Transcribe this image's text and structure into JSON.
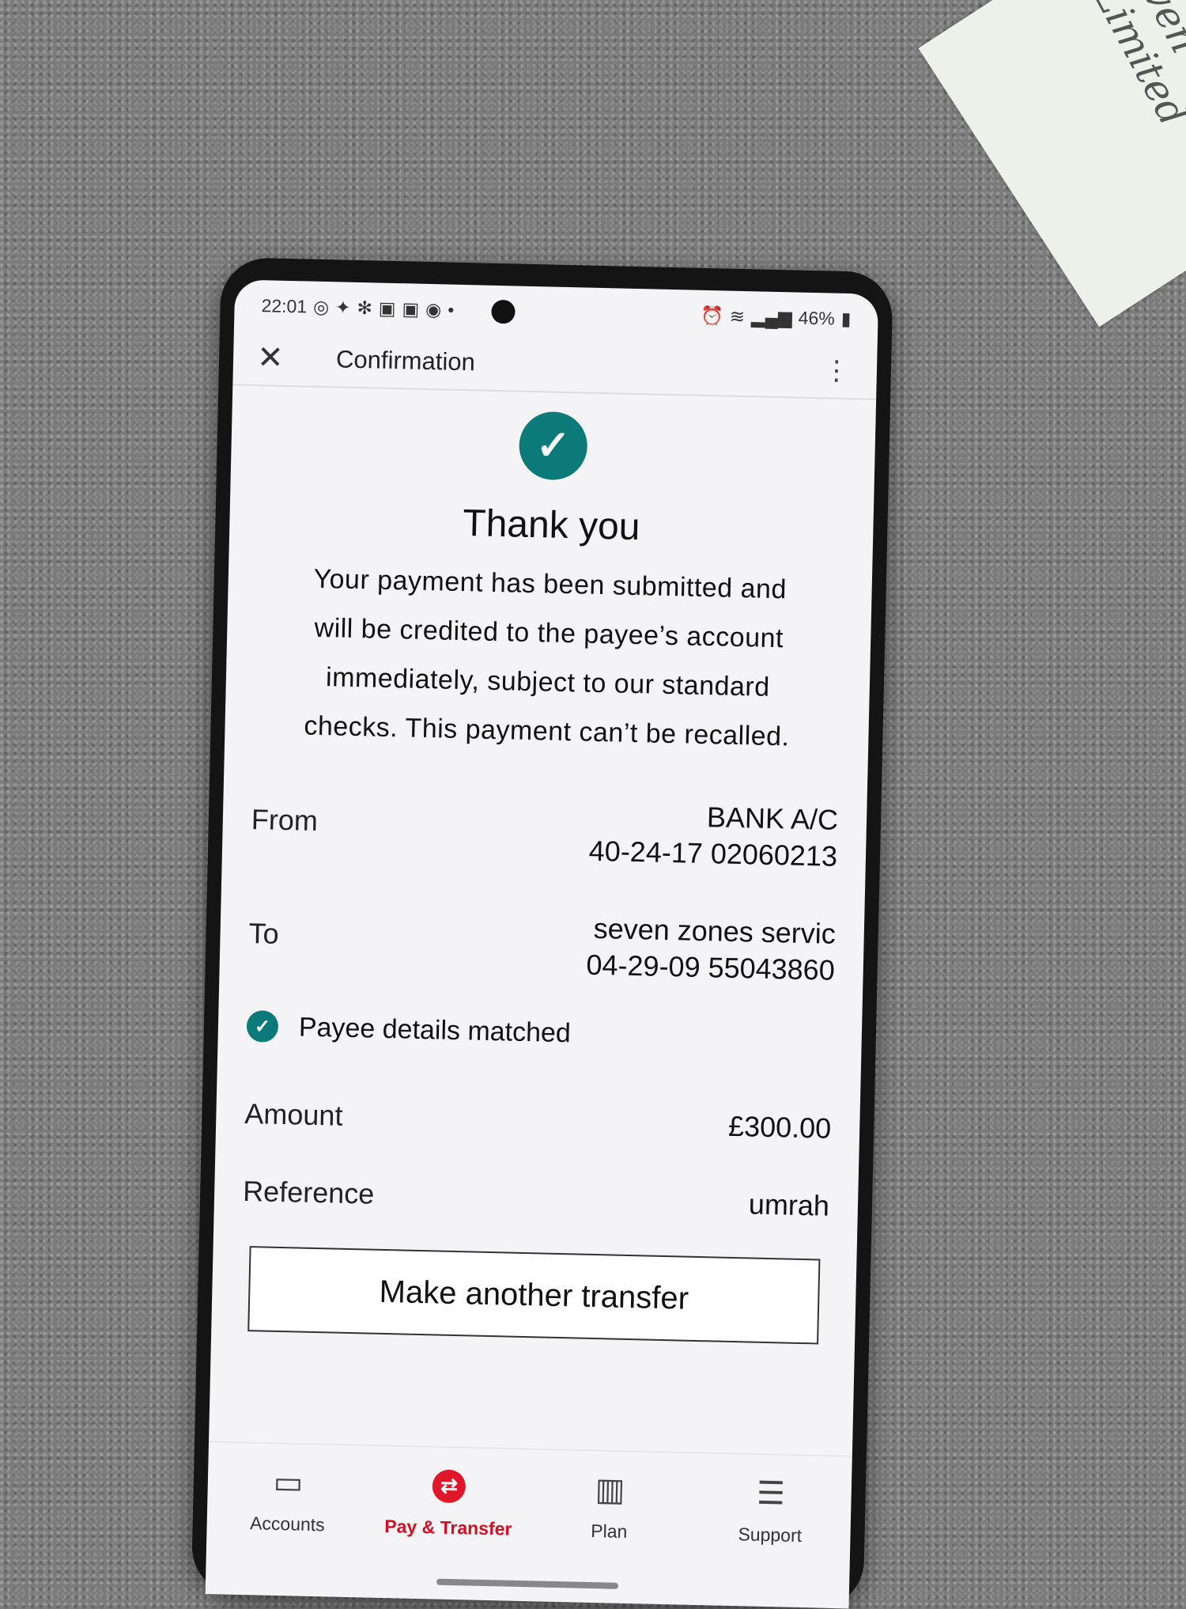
{
  "status_bar": {
    "time": "22:01",
    "left_icons": [
      "whatsapp-icon",
      "app-icon",
      "app-icon",
      "app-icon",
      "app-icon",
      "app-icon",
      "dot-icon"
    ],
    "battery": "46%"
  },
  "appbar": {
    "title": "Confirmation"
  },
  "confirmation": {
    "heading": "Thank you",
    "message": "Your payment has been submitted and will be credited to the payee’s account immediately, subject to our standard checks. This payment can’t be recalled."
  },
  "details": {
    "from_label": "From",
    "from_name": "BANK A/C",
    "from_account": "40-24-17 02060213",
    "to_label": "To",
    "to_name": "seven zones servic",
    "to_account": "04-29-09 55043860",
    "payee_status": "Payee details matched",
    "amount_label": "Amount",
    "amount_value": "£300.00",
    "reference_label": "Reference",
    "reference_value": "umrah"
  },
  "actions": {
    "make_another": "Make another transfer"
  },
  "nav": {
    "items": [
      {
        "label": "Accounts",
        "icon": "wallet-icon"
      },
      {
        "label": "Pay & Transfer",
        "icon": "transfer-icon"
      },
      {
        "label": "Plan",
        "icon": "bar-chart-icon"
      },
      {
        "label": "Support",
        "icon": "chat-icon"
      }
    ]
  },
  "colors": {
    "accent_teal": "#0b7a78",
    "brand_red": "#e0162b"
  },
  "background_note_text": "even\nLimited"
}
